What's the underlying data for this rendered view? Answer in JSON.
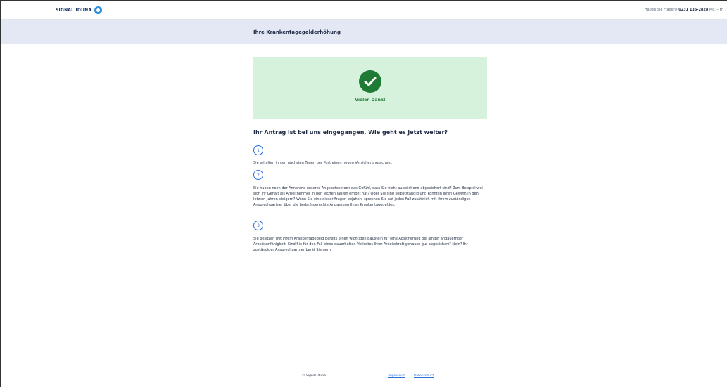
{
  "header": {
    "logo_text": "SIGNAL IDUNA",
    "hotline_question": "Haben Sie Fragen?",
    "hotline_number": "0231 135-2828",
    "hotline_hours": "Mo. – Fr. 7"
  },
  "title_bar": {
    "title": "Ihre Krankentagegelderhöhung"
  },
  "success": {
    "icon": "checkmark-icon",
    "message": "Vielen Dank!",
    "color": "#1f7a35",
    "background": "#d7f2dc"
  },
  "next_steps": {
    "headline": "Ihr Antrag ist bei uns eingegangen. Wie geht es jetzt weiter?",
    "steps": [
      {
        "number": "1",
        "text": "Sie erhalten in den nächsten Tagen per Post einen neuen Versicherungsschein."
      },
      {
        "number": "2",
        "text": "Sie haben noch der Annahme unseres Angebotes noch das Gefühl, dass Sie nicht ausreichend abgesichert sind? Zum Beispiel weil sich Ihr Gehalt als Arbeitnehmer in den letzten Jahren erhöht hat? Oder Sie sind selbstständig und konnten Ihren Gewinn in den letzten Jahren steigern? Wenn Sie eine dieser Fragen bejahen, sprechen Sie auf jeden Fall zusätzlich mit Ihrem zuständigen Ansprechpartner über die bedarfsgerechte Anpassung Ihres Krankentagegeldes."
      },
      {
        "number": "3",
        "text": "Sie besitzen mit Ihrem Krankentagegeld bereits einen wichtigen Baustein für eine Absicherung bei länger andauernder Arbeitsunfähigkeit. Sind Sie für den Fall eines dauerhaften Verlustes Ihrer Arbeitskraft genauso gut abgesichert? Nein? Ihr zuständiger Ansprechpartner berät Sie gern."
      }
    ]
  },
  "footer": {
    "copyright": "© Signal Iduna",
    "links": [
      "Impressum",
      "Datenschutz"
    ]
  },
  "colors": {
    "title_bar_bg": "#e3e8f4",
    "link": "#2a6fd6",
    "brand_blue": "#2f8fd8"
  }
}
